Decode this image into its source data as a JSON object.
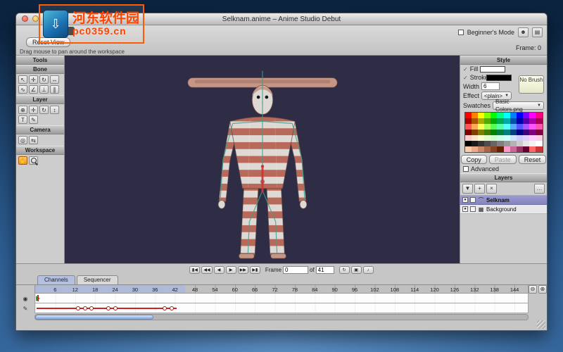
{
  "colors": {
    "desktop_center": "#5e92c8",
    "desktop_edge": "#0c2440",
    "canvas_bg": "#2e2d45",
    "stripe_red": "#b5604f",
    "body_white": "#ded9d4",
    "skin": "#c59585",
    "bone_line": "#3fa08a",
    "selected_bone": "#cc3333",
    "selection_highlight": "#9a9ace",
    "watermark_orange": "#ff5a00"
  },
  "watermark": {
    "title": "河东软件园",
    "subtitle": "pc0359.cn",
    "icon_glyph": "⇩"
  },
  "window": {
    "title": "Selknam.anime – Anime Studio Debut"
  },
  "toolbar": {
    "doc_chip": "anime",
    "reset_view": "Reset View",
    "beginners_mode": "Beginner's Mode",
    "frame_indicator": "Frame: 0",
    "hint": "Drag mouse to pan around the workspace",
    "user_icon": "☻",
    "manual_icon": "▤"
  },
  "tools_panel": {
    "title": "Tools",
    "bone": "Bone",
    "layer": "Layer",
    "camera": "Camera",
    "workspace": "Workspace"
  },
  "icons": {
    "select_bone": "↖",
    "translate_bone": "✛",
    "rotate_bone": "↻",
    "scale_bone": "↔",
    "add_bone": "∿",
    "reparent_bone": "∠",
    "bind_layer": "⊥",
    "bind_points": "∥",
    "select_layer": "⊕",
    "translate_layer": "✛",
    "rotate_layer": "↻",
    "scale_layer": "↕",
    "text_tool": "T",
    "draw_tool": "✎",
    "track_camera": "◎",
    "orbit_camera": "⇆",
    "pan_tool": "✋",
    "new_layer": "▼",
    "duplicate_layer": "+",
    "delete_layer": "×",
    "more": "…"
  },
  "style_panel": {
    "title": "Style",
    "check": "✓",
    "fill_label": "Fill",
    "stroke_label": "Stroke",
    "no_brush": "No Brush",
    "width_label": "Width",
    "width_value": "6",
    "effect_label": "Effect",
    "effect_value": "<plain>",
    "swatches_label": "Swatches",
    "swatches_value": "Basic Colors.png",
    "copy": "Copy",
    "paste": "Paste",
    "reset": "Reset",
    "advanced": "Advanced",
    "fill_color": "#ffffff",
    "stroke_color": "#000000",
    "palette": [
      [
        "#ff0000",
        "#ff8000",
        "#ffff00",
        "#80ff00",
        "#00ff00",
        "#00ff80",
        "#00ffff",
        "#0080ff",
        "#0000ff",
        "#8000ff",
        "#ff00ff",
        "#ff0080"
      ],
      [
        "#aa0000",
        "#aa5500",
        "#aaaa00",
        "#55aa00",
        "#00aa00",
        "#00aa55",
        "#00aaaa",
        "#0055aa",
        "#0000aa",
        "#5500aa",
        "#aa00aa",
        "#aa0055"
      ],
      [
        "#ff5555",
        "#ffaa55",
        "#ffff55",
        "#aaff55",
        "#55ff55",
        "#55ffaa",
        "#55ffff",
        "#55aaff",
        "#5555ff",
        "#aa55ff",
        "#ff55ff",
        "#ff55aa"
      ],
      [
        "#800000",
        "#804000",
        "#808000",
        "#408000",
        "#008000",
        "#008040",
        "#008080",
        "#004080",
        "#000080",
        "#400080",
        "#800080",
        "#800040"
      ],
      [
        "#ffcccc",
        "#ffe5cc",
        "#ffffcc",
        "#e5ffcc",
        "#ccffcc",
        "#ccffe5",
        "#ccffff",
        "#cce5ff",
        "#ccccff",
        "#e5ccff",
        "#ffccff",
        "#ffcce5"
      ],
      [
        "#000000",
        "#1a1a1a",
        "#333333",
        "#4d4d4d",
        "#666666",
        "#808080",
        "#999999",
        "#b3b3b3",
        "#cccccc",
        "#e6e6e6",
        "#f2f2f2",
        "#ffffff"
      ],
      [
        "#ffccaa",
        "#eeaa88",
        "#cc8866",
        "#aa6644",
        "#884422",
        "#662200",
        "#ff99cc",
        "#cc6699",
        "#993366",
        "#660033",
        "#ff6666",
        "#cc3333"
      ]
    ]
  },
  "layers_panel": {
    "title": "Layers",
    "layers": [
      {
        "name": "Selknam",
        "type_icon": "⌒",
        "selected": true
      },
      {
        "name": "Background",
        "type_icon": "▦",
        "selected": false
      }
    ]
  },
  "timeline": {
    "controls": {
      "jump_start": "▮◀",
      "prev_key": "◀◀",
      "step_back": "◀",
      "play": "▶",
      "step_fwd": "▶▶",
      "next_key": "▶▮",
      "loop": "↻",
      "range": "▣",
      "sound": "♪"
    },
    "frame_label": "Frame",
    "frame_value": "0",
    "of_label": "of",
    "total_frames": "41",
    "tabs": [
      {
        "label": "Channels",
        "active": true
      },
      {
        "label": "Sequencer",
        "active": false
      }
    ],
    "ruler_numbers": [
      6,
      12,
      18,
      24,
      30,
      36,
      42,
      48,
      54,
      60,
      66,
      72,
      78,
      84,
      90,
      96,
      102,
      108,
      114,
      120,
      126,
      132,
      138,
      144
    ],
    "ruler_total": 148,
    "highlight_end": 45,
    "keyframe_line_end": 42,
    "keyframes": [
      13,
      15,
      17,
      22,
      24,
      39,
      41
    ],
    "zoom_out": "⊖",
    "zoom_in": "⊕",
    "channel_icon": "◉",
    "pencil_icon": "✎"
  }
}
